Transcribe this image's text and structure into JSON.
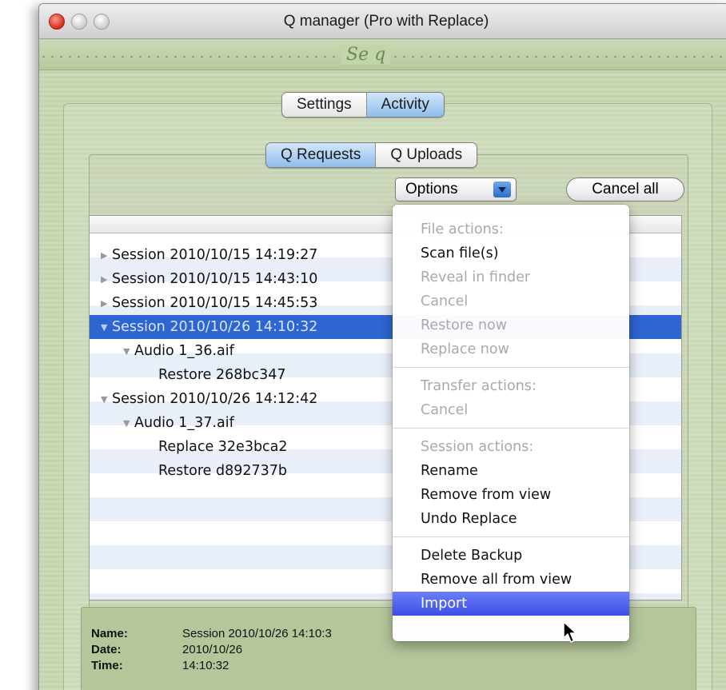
{
  "window": {
    "title": "Q manager (Pro with Replace)"
  },
  "logo": {
    "text": "Se q"
  },
  "main_tabs": [
    {
      "label": "Settings",
      "active": false
    },
    {
      "label": "Activity",
      "active": true
    }
  ],
  "sub_tabs": [
    {
      "label": "Q Requests",
      "active": true
    },
    {
      "label": "Q Uploads",
      "active": false
    }
  ],
  "toolbar": {
    "options_label": "Options",
    "cancel_all_label": "Cancel all"
  },
  "tree": [
    {
      "text": "Session 2010/10/15 14:19:27",
      "level": 0,
      "expanded": false,
      "selected": false
    },
    {
      "text": "Session 2010/10/15 14:43:10",
      "level": 0,
      "expanded": false,
      "selected": false
    },
    {
      "text": "Session 2010/10/15 14:45:53",
      "level": 0,
      "expanded": false,
      "selected": false
    },
    {
      "text": "Session 2010/10/26 14:10:32",
      "level": 0,
      "expanded": true,
      "selected": true
    },
    {
      "text": "Audio 1_36.aif",
      "level": 1,
      "expanded": true,
      "selected": false
    },
    {
      "text": "Restore 268bc347",
      "level": 2,
      "selected": false
    },
    {
      "text": "Session 2010/10/26 14:12:42",
      "level": 0,
      "expanded": true,
      "selected": false
    },
    {
      "text": "Audio 1_37.aif",
      "level": 1,
      "expanded": true,
      "selected": false
    },
    {
      "text": "Replace 32e3bca2",
      "level": 2,
      "selected": false
    },
    {
      "text": "Restore d892737b",
      "level": 2,
      "selected": false
    }
  ],
  "details": {
    "name_label": "Name:",
    "name_value": "Session 2010/10/26 14:10:3",
    "date_label": "Date:",
    "date_value": "2010/10/26",
    "time_label": "Time:",
    "time_value": "14:10:32"
  },
  "menu": {
    "file_header": "File actions:",
    "scan": "Scan file(s)",
    "reveal": "Reveal in finder",
    "cancel_file": "Cancel",
    "restore_now": "Restore now",
    "replace_now": "Replace now",
    "transfer_header": "Transfer actions:",
    "cancel_transfer": "Cancel",
    "session_header": "Session actions:",
    "rename": "Rename",
    "remove_from_view": "Remove from view",
    "undo_replace": "Undo Replace",
    "delete_backup": "Delete Backup",
    "remove_all": "Remove all from view",
    "import": "Import"
  },
  "colors": {
    "selection": "#2e65d1",
    "menu_highlight": "#3b4fe6",
    "panel_green": "#c9d8b4"
  }
}
